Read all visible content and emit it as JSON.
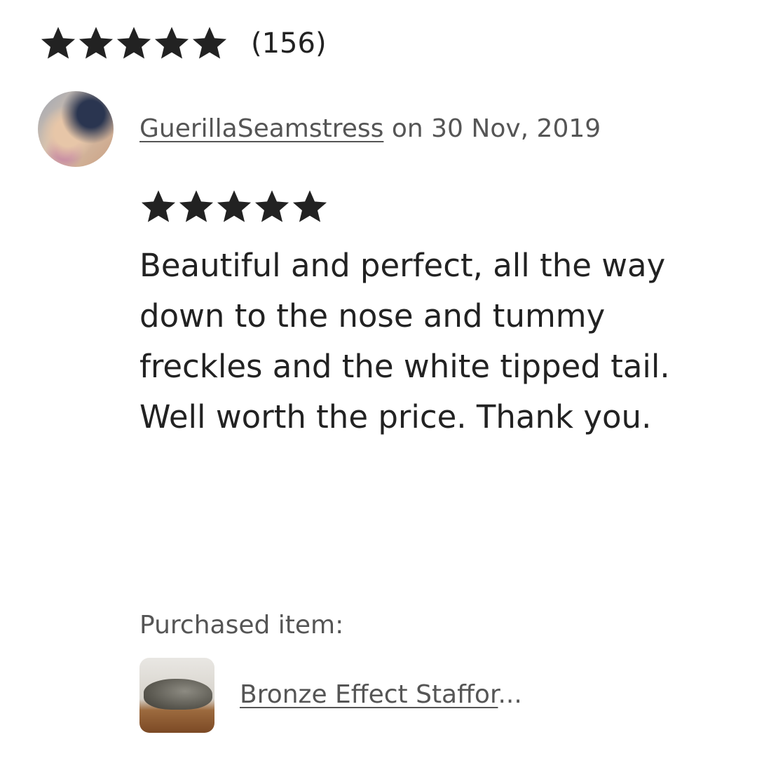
{
  "summary": {
    "rating": 5,
    "count_text": "(156)"
  },
  "review": {
    "reviewer": "GuerillaSeamstress",
    "date_text": " on 30 Nov, 2019",
    "rating": 5,
    "text": "Beautiful and perfect, all the way down to the nose and tummy freckles and the white tipped tail. Well worth the price. Thank you."
  },
  "purchase": {
    "label": "Purchased item:",
    "item_name": "Bronze Effect Staffor",
    "ellipsis": "..."
  },
  "colors": {
    "star": "#222222",
    "text": "#222222",
    "muted": "#555555"
  }
}
